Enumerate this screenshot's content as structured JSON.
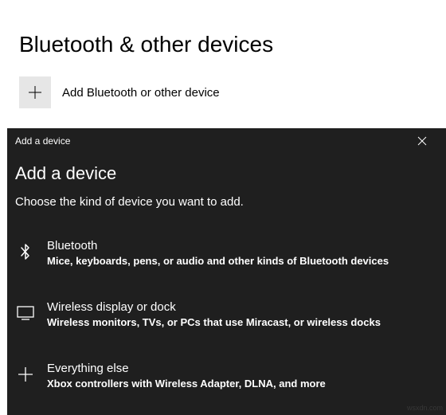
{
  "page": {
    "title": "Bluetooth & other devices",
    "add_button_label": "Add Bluetooth or other device"
  },
  "dialog": {
    "titlebar": "Add a device",
    "heading": "Add a device",
    "subheading": "Choose the kind of device you want to add.",
    "options": [
      {
        "title": "Bluetooth",
        "desc": "Mice, keyboards, pens, or audio and other kinds of Bluetooth devices"
      },
      {
        "title": "Wireless display or dock",
        "desc": "Wireless monitors, TVs, or PCs that use Miracast, or wireless docks"
      },
      {
        "title": "Everything else",
        "desc": "Xbox controllers with Wireless Adapter, DLNA, and more"
      }
    ]
  },
  "watermark": "wsxdn.com"
}
